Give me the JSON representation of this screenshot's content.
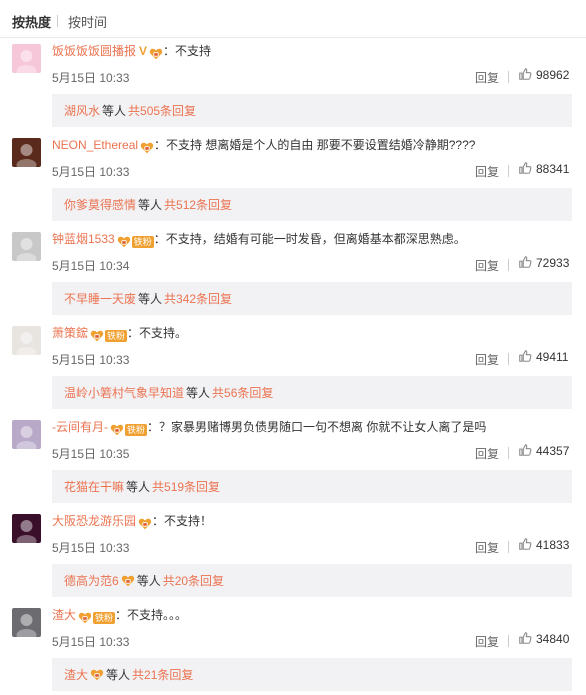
{
  "tabs": {
    "hot": "按热度",
    "time": "按时间"
  },
  "comments": [
    {
      "user": "饭饭饭饭圆播报",
      "text": "：不支持",
      "time": "5月15日 10:33",
      "reply": "回复",
      "likes": "98962",
      "sub_user": "湖风水",
      "sub_mid": "等人",
      "sub_count": "共505条回复",
      "avatar_color": "#f6c6d9"
    },
    {
      "user": "NEON_Ethereal",
      "text": "：不支持 想离婚是个人的自由 那要不要设置结婚冷静期????",
      "time": "5月15日 10:33",
      "reply": "回复",
      "likes": "88341",
      "sub_user": "你爹莫得感情",
      "sub_mid": "等人",
      "sub_count": "共512条回复",
      "avatar_color": "#5a2b1c"
    },
    {
      "user": "钟蓝烟1533",
      "text": "：不支持，结婚有可能一时发昏，但离婚基本都深思熟虑。",
      "time": "5月15日 10:34",
      "reply": "回复",
      "likes": "72933",
      "sub_user": "不早睡一天废",
      "sub_mid": "等人",
      "sub_count": "共342条回复",
      "avatar_color": "#c8c8c8",
      "fans": "铁粉"
    },
    {
      "user": "萧策鋐",
      "text": "：不支持。",
      "time": "5月15日 10:33",
      "reply": "回复",
      "likes": "49411",
      "sub_user": "温岭小箬村气象早知道",
      "sub_mid": "等人",
      "sub_count": "共56条回复",
      "avatar_color": "#e8e4e0",
      "fans": "铁粉"
    },
    {
      "user": "-云间有月-",
      "text": "：？家暴男赌博男负债男随口一句不想离 你就不让女人离了是吗",
      "time": "5月15日 10:35",
      "reply": "回复",
      "likes": "44357",
      "sub_user": "花猫在干嘛",
      "sub_mid": "等人",
      "sub_count": "共519条回复",
      "avatar_color": "#b9a9c9",
      "fans": "铁粉"
    },
    {
      "user": "大阪恐龙游乐园",
      "text": "：不支持！",
      "time": "5月15日 10:33",
      "reply": "回复",
      "likes": "41833",
      "sub_user": "德高为范6",
      "sub_mid": "等人",
      "sub_count": "共20条回复",
      "avatar_color": "#3a0f2a"
    },
    {
      "user": "渣大",
      "text": "：不支持。。。",
      "time": "5月15日 10:33",
      "reply": "回复",
      "likes": "34840",
      "sub_user": "渣大",
      "sub_mid": "等人",
      "sub_count": "共21条回复",
      "avatar_color": "#6b6b70",
      "fans": "铁粉"
    }
  ],
  "colors": {
    "link": "#eb7350",
    "badge": "#f0a030",
    "sub_bg": "#f2f2f5"
  }
}
